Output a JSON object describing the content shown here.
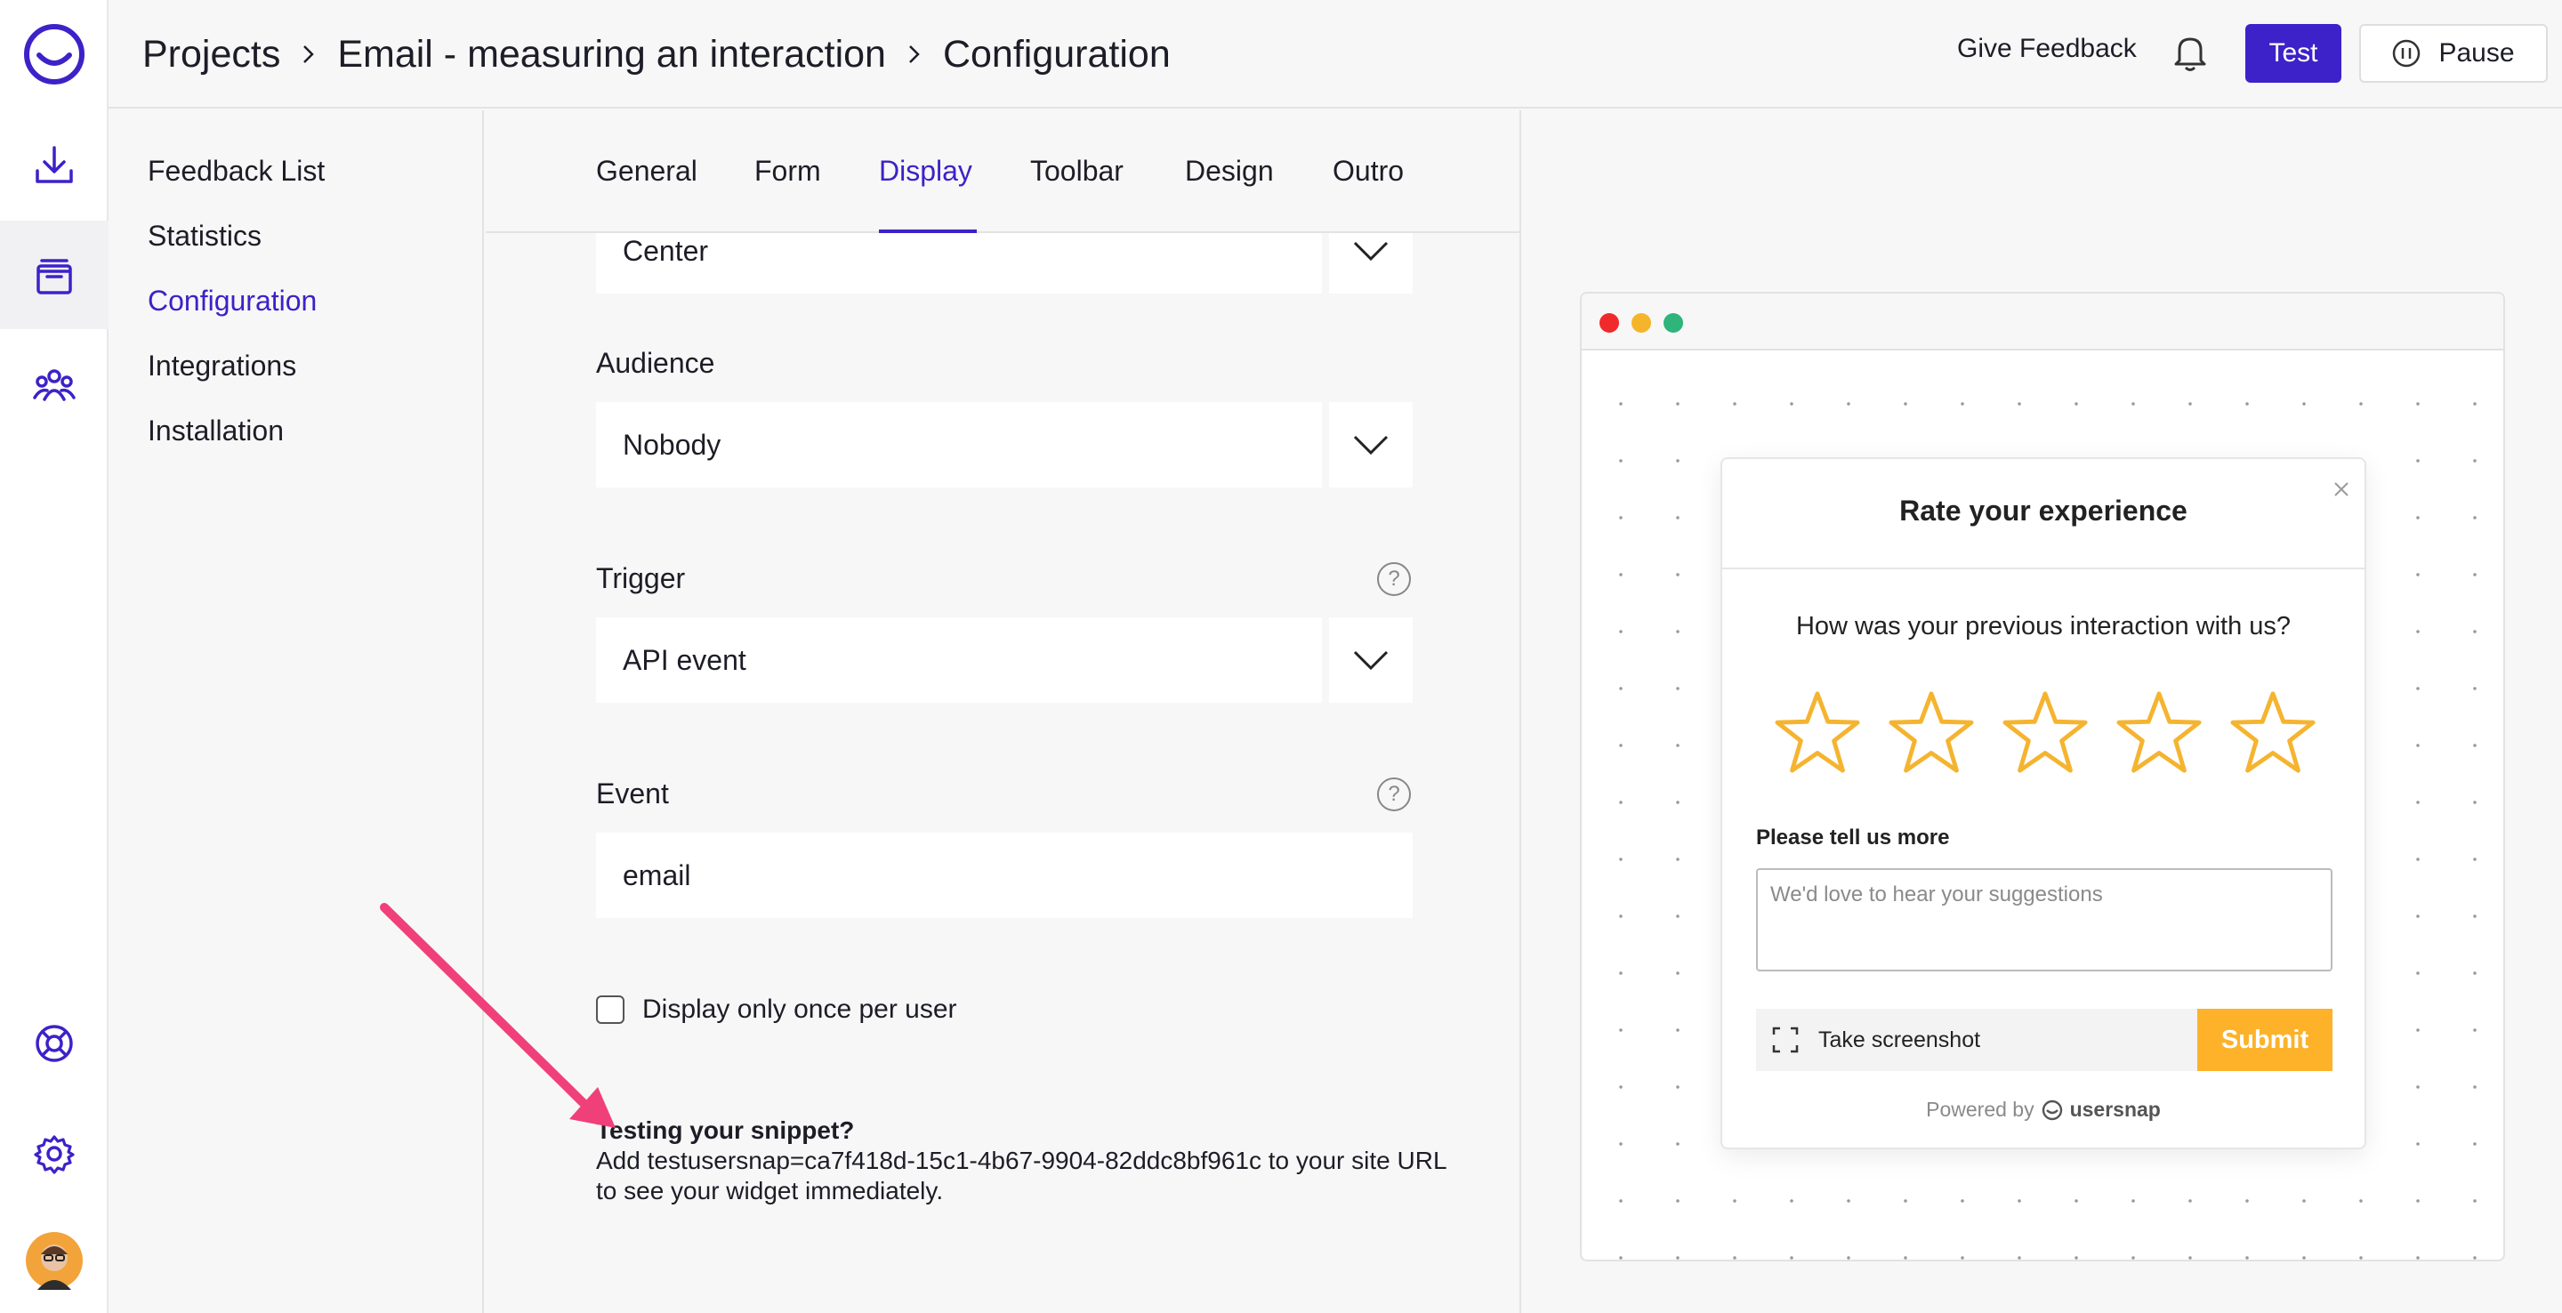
{
  "breadcrumb": {
    "items": [
      "Projects",
      "Email - measuring an interaction",
      "Configuration"
    ]
  },
  "header": {
    "give_feedback": "Give Feedback",
    "test_label": "Test",
    "pause_label": "Pause"
  },
  "rail": {
    "icons": [
      "usersnap-logo-icon",
      "download-icon",
      "archive-icon",
      "team-icon",
      "help-lifebuoy-icon",
      "settings-gear-icon",
      "user-avatar"
    ]
  },
  "subnav": {
    "items": [
      "Feedback List",
      "Statistics",
      "Configuration",
      "Integrations",
      "Installation"
    ],
    "active": "Configuration"
  },
  "tabs": {
    "items": [
      "General",
      "Form",
      "Display",
      "Toolbar",
      "Design",
      "Outro"
    ],
    "active": "Display"
  },
  "form": {
    "position_value": "Center",
    "audience_label": "Audience",
    "audience_value": "Nobody",
    "trigger_label": "Trigger",
    "trigger_value": "API event",
    "event_label": "Event",
    "event_value": "email",
    "once_label": "Display only once per user",
    "snippet_title": "Testing your snippet?",
    "snippet_text": "Add testusersnap=ca7f418d-15c1-4b67-9904-82ddc8bf961c to your site URL to see your widget immediately."
  },
  "widget": {
    "title": "Rate your experience",
    "question": "How was your previous interaction with us?",
    "star_count": 5,
    "tell_more": "Please tell us more",
    "placeholder": "We'd love to hear your suggestions",
    "screenshot_label": "Take screenshot",
    "submit_label": "Submit",
    "powered_by": "Powered by",
    "brand": "usersnap"
  },
  "colors": {
    "accent": "#3c22c8",
    "submit": "#fdb22a",
    "star": "#f5b430",
    "annotation_arrow": "#f0407a"
  }
}
